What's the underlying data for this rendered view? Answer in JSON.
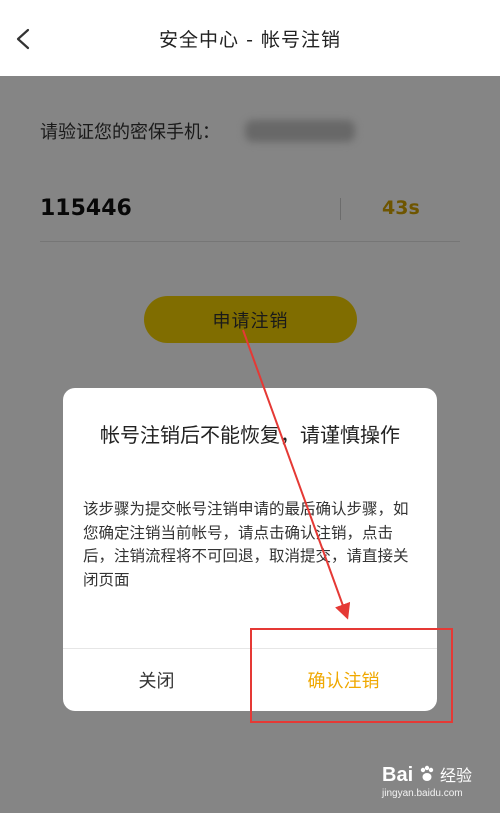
{
  "header": {
    "title": "安全中心 - 帐号注销",
    "back_icon": "chevron-left-icon"
  },
  "verify": {
    "label": "请验证您的密保手机：",
    "code": "115446",
    "countdown": "43s"
  },
  "apply_button": {
    "label": "申请注销"
  },
  "dialog": {
    "title": "帐号注销后不能恢复，请谨慎操作",
    "body": "该步骤为提交帐号注销申请的最后确认步骤，如您确定注销当前帐号，请点击确认注销，点击后，注销流程将不可回退，取消提交，请直接关闭页面",
    "close_label": "关闭",
    "confirm_label": "确认注销"
  },
  "watermark": {
    "logo": "Bai",
    "logo_icon": "paw-icon",
    "suffix": "经验",
    "url": "jingyan.baidu.com"
  },
  "colors": {
    "accent_yellow": "#f5d100",
    "countdown": "#d4a400",
    "confirm": "#f0a800",
    "annotation_red": "#e53935"
  }
}
